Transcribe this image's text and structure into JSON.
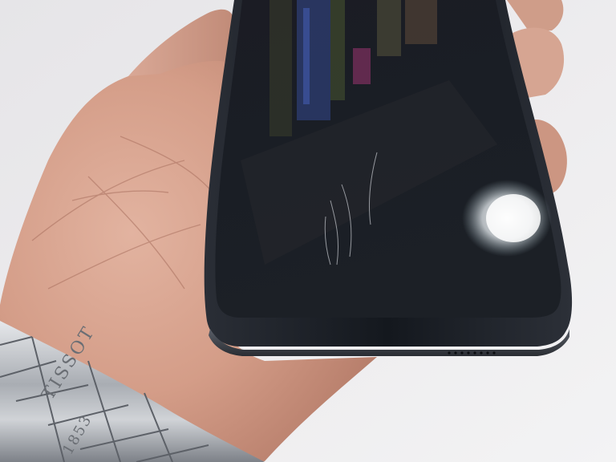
{
  "scene": {
    "subjects": [
      "hand",
      "smartphone",
      "wristwatch-bracelet"
    ],
    "phone_color": "#161a20",
    "skin_color": "#d9a48f",
    "background_color": "#ececee",
    "metal_color": "#b9bcc1"
  },
  "watch": {
    "brand": "TISSOT",
    "year": "1853"
  }
}
